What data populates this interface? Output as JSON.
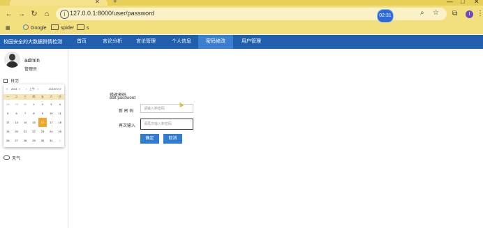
{
  "browser": {
    "url": "127.0.0.1:8000/user/password",
    "timer": "02:31",
    "profile_initial": "I",
    "bookmarks": [
      {
        "label": "Google",
        "icon": "google-icon"
      },
      {
        "label": "spider",
        "icon": "folder-icon"
      },
      {
        "label": "s",
        "icon": "folder-icon"
      }
    ]
  },
  "navbar": {
    "brand": "校园安全的大数据舆情检测",
    "items": [
      {
        "label": "首页",
        "active": false
      },
      {
        "label": "言论分析",
        "active": false
      },
      {
        "label": "言论管理",
        "active": false
      },
      {
        "label": "个人信息",
        "active": false
      },
      {
        "label": "密码修改",
        "active": true
      },
      {
        "label": "用户管理",
        "active": false
      }
    ],
    "accent_color": "#1f5fae"
  },
  "sidebar": {
    "user_name": "admin",
    "user_role": "管理员",
    "calendar_label": "日历",
    "weather_label": "天气",
    "calendar": {
      "year": "2021",
      "period": "上午",
      "date": "2019/7/17",
      "weekdays": [
        "一",
        "二",
        "三",
        "四",
        "五",
        "六",
        "日"
      ],
      "weeks": [
        [
          "28",
          "29",
          "30",
          "1",
          "2",
          "3",
          "4"
        ],
        [
          "5",
          "6",
          "7",
          "8",
          "9",
          "10",
          "11"
        ],
        [
          "12",
          "13",
          "14",
          "15",
          "16",
          "17",
          "18"
        ],
        [
          "19",
          "20",
          "21",
          "22",
          "23",
          "24",
          "25"
        ],
        [
          "26",
          "27",
          "28",
          "29",
          "30",
          "31",
          "1"
        ]
      ],
      "selected_day": "16"
    }
  },
  "form": {
    "title": "修改密码",
    "subtitle": "edit password",
    "new_password_label": "新 密 码",
    "new_password_placeholder": "请输入新密码",
    "confirm_label": "再次输入",
    "confirm_placeholder": "请再次输入新密码",
    "confirm_button": "确定",
    "cancel_button": "取消"
  }
}
